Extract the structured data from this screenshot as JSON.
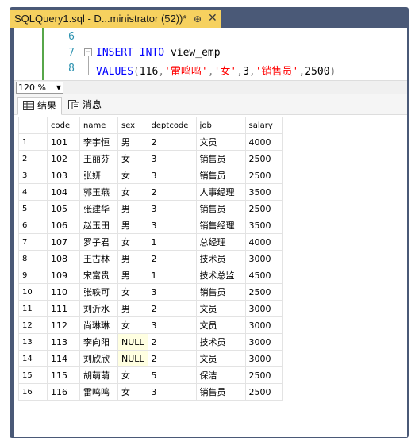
{
  "tab": {
    "title": "SQLQuery1.sql - D...ministrator (52))*",
    "pin": "⊕",
    "close": "✕"
  },
  "editor": {
    "lines": [
      {
        "number": "6",
        "text": ""
      },
      {
        "number": "7",
        "keyword1": "INSERT",
        "keyword2": "INTO",
        "table": "view_emp"
      },
      {
        "number": "8",
        "keyword": "VALUES",
        "open": "(",
        "v1": "116",
        "c1": ",",
        "s1": "'雷鸣鸣'",
        "c2": ",",
        "s2": "'女'",
        "c3": ",",
        "v2": "3",
        "c4": ",",
        "s3": "'销售员'",
        "c5": ",",
        "v3": "2500",
        "close": ")"
      }
    ]
  },
  "status": {
    "zoom": "120 %"
  },
  "result_tabs": [
    {
      "label": "结果"
    },
    {
      "label": "消息"
    }
  ],
  "grid": {
    "columns": [
      "code",
      "name",
      "sex",
      "deptcode",
      "job",
      "salary"
    ],
    "rows": [
      [
        "1",
        "101",
        "李宇恒",
        "男",
        "2",
        "文员",
        "4000"
      ],
      [
        "2",
        "102",
        "王丽芬",
        "女",
        "3",
        "销售员",
        "2500"
      ],
      [
        "3",
        "103",
        "张妍",
        "女",
        "3",
        "销售员",
        "2500"
      ],
      [
        "4",
        "104",
        "郭玉燕",
        "女",
        "2",
        "人事经理",
        "3500"
      ],
      [
        "5",
        "105",
        "张建华",
        "男",
        "3",
        "销售员",
        "2500"
      ],
      [
        "6",
        "106",
        "赵玉田",
        "男",
        "3",
        "销售经理",
        "3500"
      ],
      [
        "7",
        "107",
        "罗子君",
        "女",
        "1",
        "总经理",
        "4000"
      ],
      [
        "8",
        "108",
        "王古林",
        "男",
        "2",
        "技术员",
        "3000"
      ],
      [
        "9",
        "109",
        "宋富贵",
        "男",
        "1",
        "技术总监",
        "4500"
      ],
      [
        "10",
        "110",
        "张轶可",
        "女",
        "3",
        "销售员",
        "2500"
      ],
      [
        "11",
        "111",
        "刘沂水",
        "男",
        "2",
        "文员",
        "3000"
      ],
      [
        "12",
        "112",
        "尚琳琳",
        "女",
        "3",
        "文员",
        "3000"
      ],
      [
        "13",
        "113",
        "李向阳",
        "NULL",
        "2",
        "技术员",
        "3000"
      ],
      [
        "14",
        "114",
        "刘欣欣",
        "NULL",
        "2",
        "文员",
        "3000"
      ],
      [
        "15",
        "115",
        "胡萌萌",
        "女",
        "5",
        "保洁",
        "2500"
      ],
      [
        "16",
        "116",
        "雷鸣鸣",
        "女",
        "3",
        "销售员",
        "2500"
      ]
    ]
  }
}
